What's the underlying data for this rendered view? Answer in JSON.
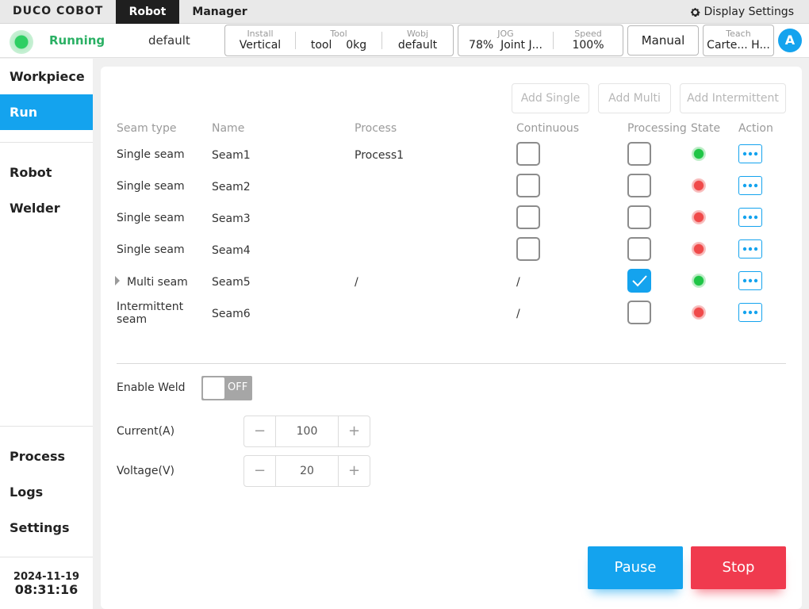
{
  "app": {
    "logo": "DUCO COBOT"
  },
  "topbar": {
    "tabs": [
      "Robot",
      "Manager"
    ],
    "display_settings": "Display Settings"
  },
  "status": {
    "state": "Running",
    "program": "default",
    "install": {
      "caption": "Install",
      "value": "Vertical"
    },
    "tool": {
      "caption": "Tool",
      "name": "tool",
      "mass": "0kg"
    },
    "wobj": {
      "caption": "Wobj",
      "value": "default"
    },
    "jog": {
      "caption": "JOG",
      "percent": "78%",
      "mode": "Joint J..."
    },
    "speed": {
      "caption": "Speed",
      "value": "100%"
    },
    "mode_button": "Manual",
    "teach": {
      "caption": "Teach",
      "value": "Carte... H..."
    },
    "avatar": "A"
  },
  "sidebar": {
    "top_items": [
      "Workpiece",
      "Run"
    ],
    "middle_items": [
      "Robot",
      "Welder"
    ],
    "bottom_items": [
      "Process",
      "Logs",
      "Settings"
    ],
    "date": "2024-11-19",
    "time": "08:31:16"
  },
  "actions": {
    "add_single": "Add Single",
    "add_multi": "Add Multi",
    "add_intermittent": "Add Intermittent"
  },
  "table": {
    "headers": [
      "Seam type",
      "Name",
      "Process",
      "Continuous",
      "Processing",
      "State",
      "Action"
    ],
    "rows": [
      {
        "type": "Single seam",
        "name": "Seam1",
        "process": "Process1",
        "continuous": "",
        "processing": false,
        "state": "green"
      },
      {
        "type": "Single seam",
        "name": "Seam2",
        "process": "",
        "continuous": "",
        "processing": false,
        "state": "red"
      },
      {
        "type": "Single seam",
        "name": "Seam3",
        "process": "",
        "continuous": "",
        "processing": false,
        "state": "red"
      },
      {
        "type": "Single seam",
        "name": "Seam4",
        "process": "",
        "continuous": "",
        "processing": false,
        "state": "red"
      },
      {
        "type": "Multi seam",
        "name": "Seam5",
        "process": "/",
        "continuous": "/",
        "processing": true,
        "state": "green"
      },
      {
        "type": "Intermittent seam",
        "type_line1": "Intermittent",
        "type_line2": "seam",
        "name": "Seam6",
        "process": "",
        "continuous": "/",
        "processing": false,
        "state": "red"
      }
    ]
  },
  "weld": {
    "label": "Enable Weld",
    "toggle": "OFF"
  },
  "current": {
    "label": "Current(A)",
    "value": "100"
  },
  "voltage": {
    "label": "Voltage(V)",
    "value": "20"
  },
  "buttons": {
    "pause": "Pause",
    "stop": "Stop"
  },
  "colors": {
    "accent": "#14a3ee",
    "running": "#2ab064",
    "stop": "#f03a4e",
    "ok": "#1fc546",
    "error": "#f04a4a"
  }
}
